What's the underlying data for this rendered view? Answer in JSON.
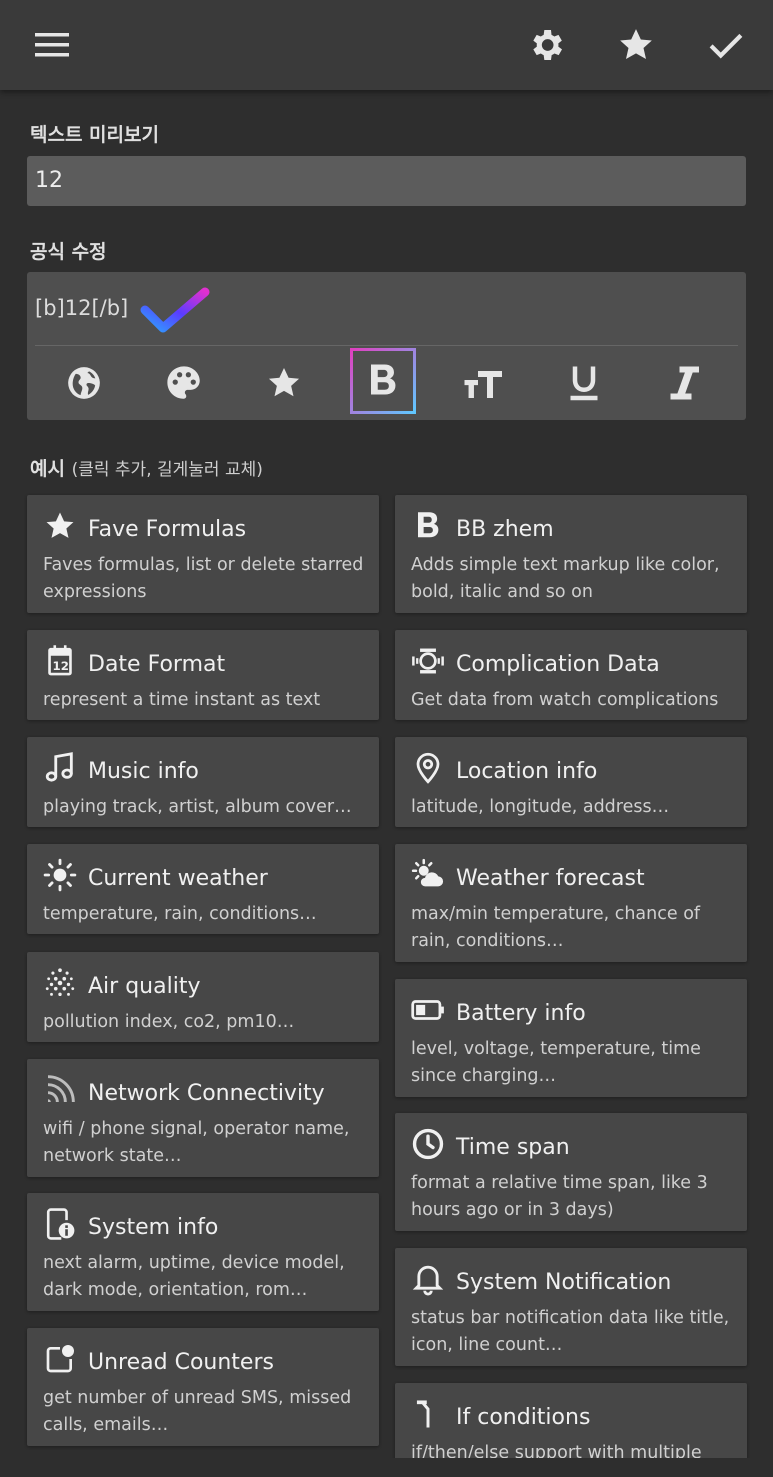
{
  "toolbar": {
    "menu_icon": "menu-icon",
    "settings_icon": "gear-icon",
    "favorite_icon": "star-icon",
    "confirm_icon": "check-icon"
  },
  "preview": {
    "label": "텍스트 미리보기",
    "value": "12"
  },
  "formula": {
    "label": "공식 수정",
    "value": "[b]12[/b]",
    "tools": [
      {
        "name": "globe-icon"
      },
      {
        "name": "palette-icon"
      },
      {
        "name": "star-icon"
      },
      {
        "name": "bold-icon",
        "active": true
      },
      {
        "name": "text-size-icon"
      },
      {
        "name": "underline-icon"
      },
      {
        "name": "italic-icon"
      }
    ]
  },
  "examples": {
    "label": "예시",
    "hint": "(클릭 추가, 길게눌러 교체)",
    "cards": [
      {
        "icon": "star-icon",
        "title": "Fave Formulas",
        "desc": "Faves formulas, list or delete starred expressions"
      },
      {
        "icon": "bold-b-icon",
        "title": "BB zhem",
        "desc": "Adds simple text markup like color, bold, italic and so on"
      },
      {
        "icon": "calendar-icon",
        "title": "Date Format",
        "desc": "represent a time instant as text"
      },
      {
        "icon": "watch-icon",
        "title": "Complication Data",
        "desc": "Get data from watch complications"
      },
      {
        "icon": "music-note-icon",
        "title": "Music info",
        "desc": "playing track, artist, album cover…"
      },
      {
        "icon": "location-pin-icon",
        "title": "Location info",
        "desc": "latitude, longitude, address…"
      },
      {
        "icon": "sun-icon",
        "title": "Current weather",
        "desc": "temperature, rain, conditions…"
      },
      {
        "icon": "partly-cloudy-icon",
        "title": "Weather forecast",
        "desc": "max/min temperature, chance of rain, conditions…"
      },
      {
        "icon": "air-dots-icon",
        "title": "Air quality",
        "desc": "pollution index, co2, pm10…"
      },
      {
        "icon": "battery-icon",
        "title": "Battery info",
        "desc": "level, voltage, temperature, time since charging…"
      },
      {
        "icon": "signal-icon",
        "title": "Network Connectivity",
        "desc": "wifi / phone signal, operator name, network state…"
      },
      {
        "icon": "clock-icon",
        "title": "Time span",
        "desc": "format a relative time span, like 3 hours ago or in 3 days)"
      },
      {
        "icon": "device-info-icon",
        "title": "System info",
        "desc": "next alarm, uptime, device model, dark mode, orientation, rom…"
      },
      {
        "icon": "bell-icon",
        "title": "System Notification",
        "desc": "status bar notification data like title, icon, line count…"
      },
      {
        "icon": "unread-badge-icon",
        "title": "Unread Counters",
        "desc": "get number of unread SMS, missed calls, emails…"
      },
      {
        "icon": "branch-icon",
        "title": "If conditions",
        "desc": "if/then/else support with multiple"
      }
    ]
  }
}
